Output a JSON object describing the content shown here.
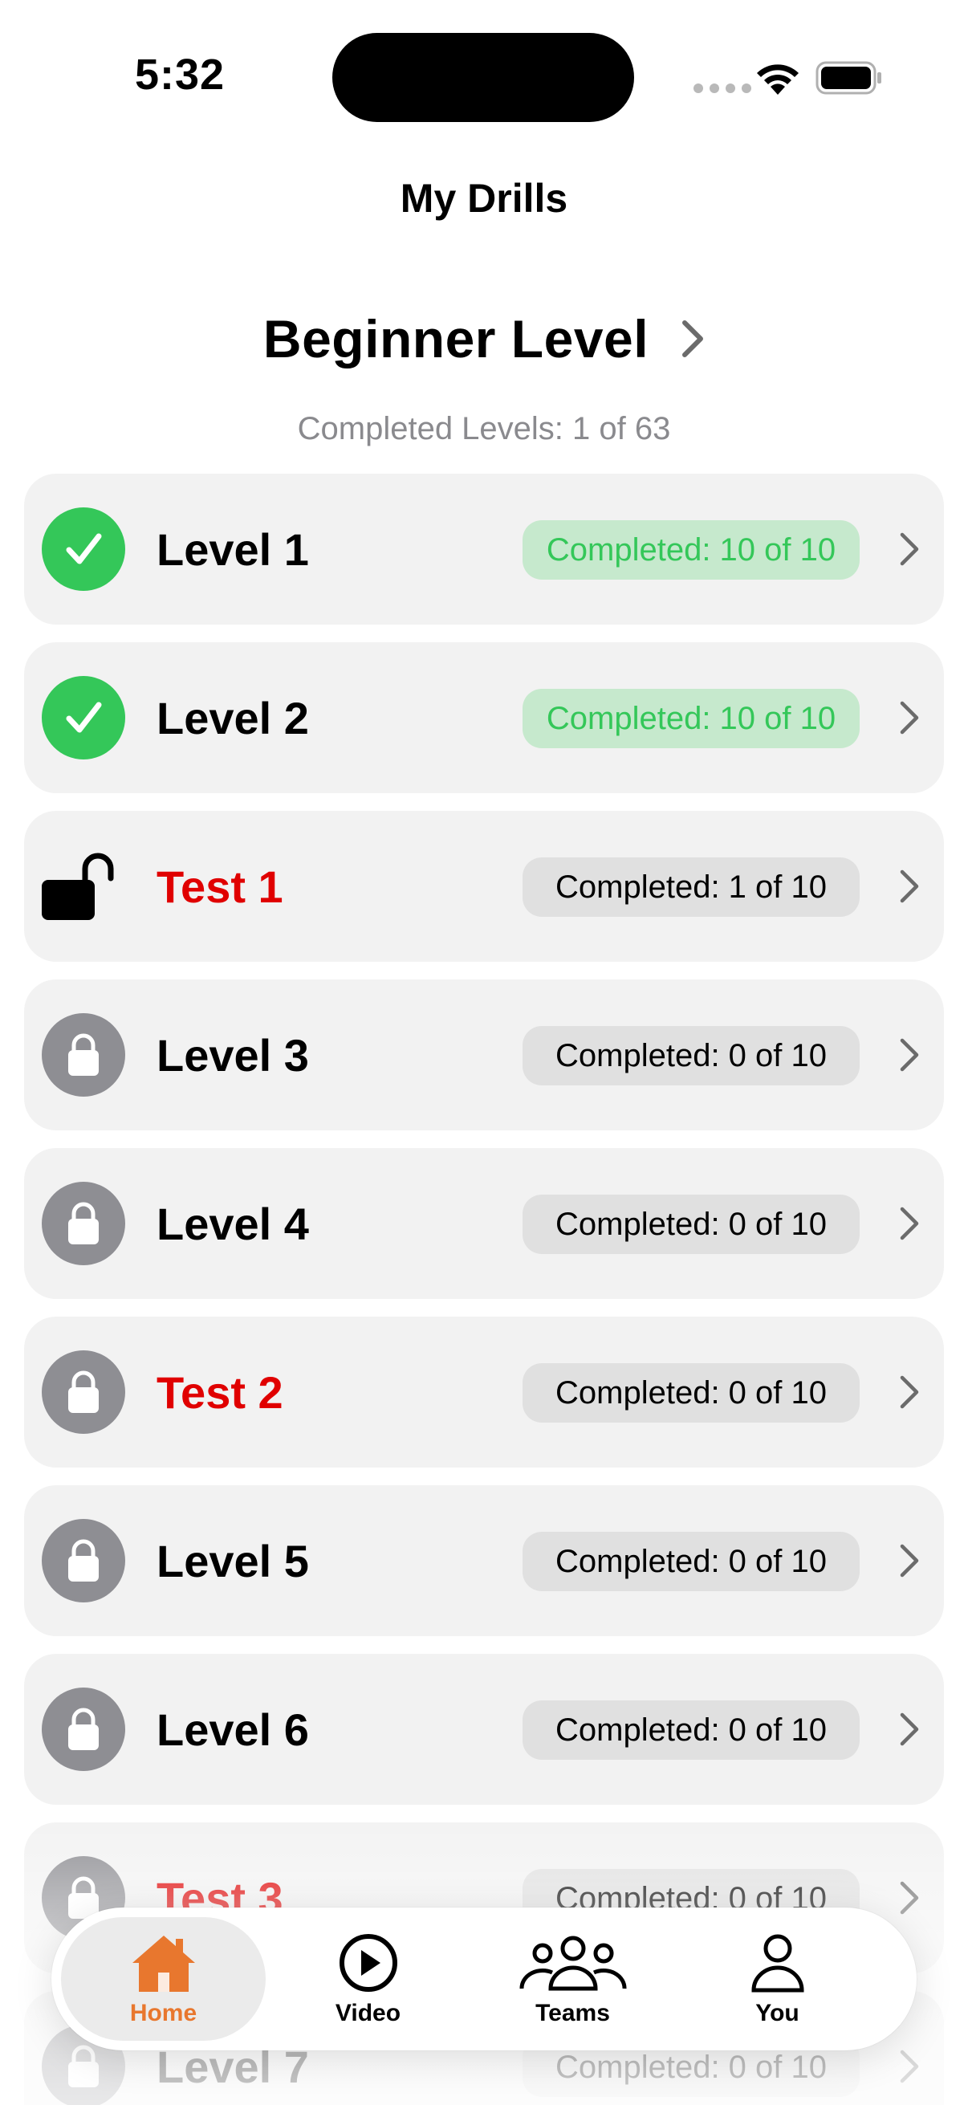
{
  "status_bar": {
    "time": "5:32"
  },
  "nav": {
    "title": "My Drills"
  },
  "level_header": {
    "title": "Beginner Level",
    "subtitle": "Completed Levels: 1 of 63"
  },
  "rows": [
    {
      "label": "Level 1",
      "status": "completed",
      "badge": "Completed: 10 of 10",
      "icon": "checkmark-icon"
    },
    {
      "label": "Level 2",
      "status": "completed",
      "badge": "Completed: 10 of 10",
      "icon": "checkmark-icon"
    },
    {
      "label": "Test 1",
      "status": "unlocked-test",
      "badge": "Completed: 1 of 10",
      "icon": "unlocked-icon"
    },
    {
      "label": "Level 3",
      "status": "locked",
      "badge": "Completed: 0 of 10",
      "icon": "lock-icon"
    },
    {
      "label": "Level 4",
      "status": "locked",
      "badge": "Completed: 0 of 10",
      "icon": "lock-icon"
    },
    {
      "label": "Test 2",
      "status": "locked-test",
      "badge": "Completed: 0 of 10",
      "icon": "lock-icon"
    },
    {
      "label": "Level 5",
      "status": "locked",
      "badge": "Completed: 0 of 10",
      "icon": "lock-icon"
    },
    {
      "label": "Level 6",
      "status": "locked",
      "badge": "Completed: 0 of 10",
      "icon": "lock-icon"
    },
    {
      "label": "Test 3",
      "status": "locked-test",
      "badge": "Completed: 0 of 10",
      "icon": "lock-icon"
    },
    {
      "label": "Level 7",
      "status": "locked",
      "badge": "Completed: 0 of 10",
      "icon": "lock-icon"
    }
  ],
  "tab_bar": {
    "tabs": [
      {
        "label": "Home",
        "icon": "house-icon",
        "active": true
      },
      {
        "label": "Video",
        "icon": "play-circle-icon",
        "active": false
      },
      {
        "label": "Teams",
        "icon": "people-icon",
        "active": false
      },
      {
        "label": "You",
        "icon": "person-icon",
        "active": false
      }
    ]
  },
  "colors": {
    "accent": "#e8772e",
    "completed_green": "#34c759",
    "completed_badge_bg": "#c6e9cd",
    "test_red": "#e00000",
    "locked_grey": "#8e8e93",
    "row_bg": "#f2f2f2"
  }
}
